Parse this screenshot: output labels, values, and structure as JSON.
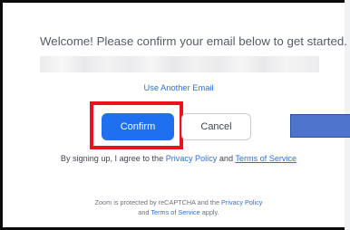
{
  "dialog": {
    "welcome_text": "Welcome! Please confirm your email below to get started.",
    "use_another_email": "Use Another Email",
    "confirm_label": "Confirm",
    "cancel_label": "Cancel",
    "terms_prefix": "By signing up, I agree to the ",
    "privacy_link": "Privacy Policy",
    "terms_and": " and ",
    "terms_link": "Terms of Service",
    "recaptcha_line1_prefix": "Zoom is protected by reCAPTCHA and the ",
    "recaptcha_privacy_link": "Privacy Policy",
    "recaptcha_line2_prefix": "and ",
    "recaptcha_terms_link": "Terms of Service",
    "recaptcha_line2_suffix": " apply."
  },
  "colors": {
    "primary": "#1e70ef",
    "link": "#2d6fe0",
    "highlight": "#e8141b",
    "blue_block": "#4d73cc"
  }
}
